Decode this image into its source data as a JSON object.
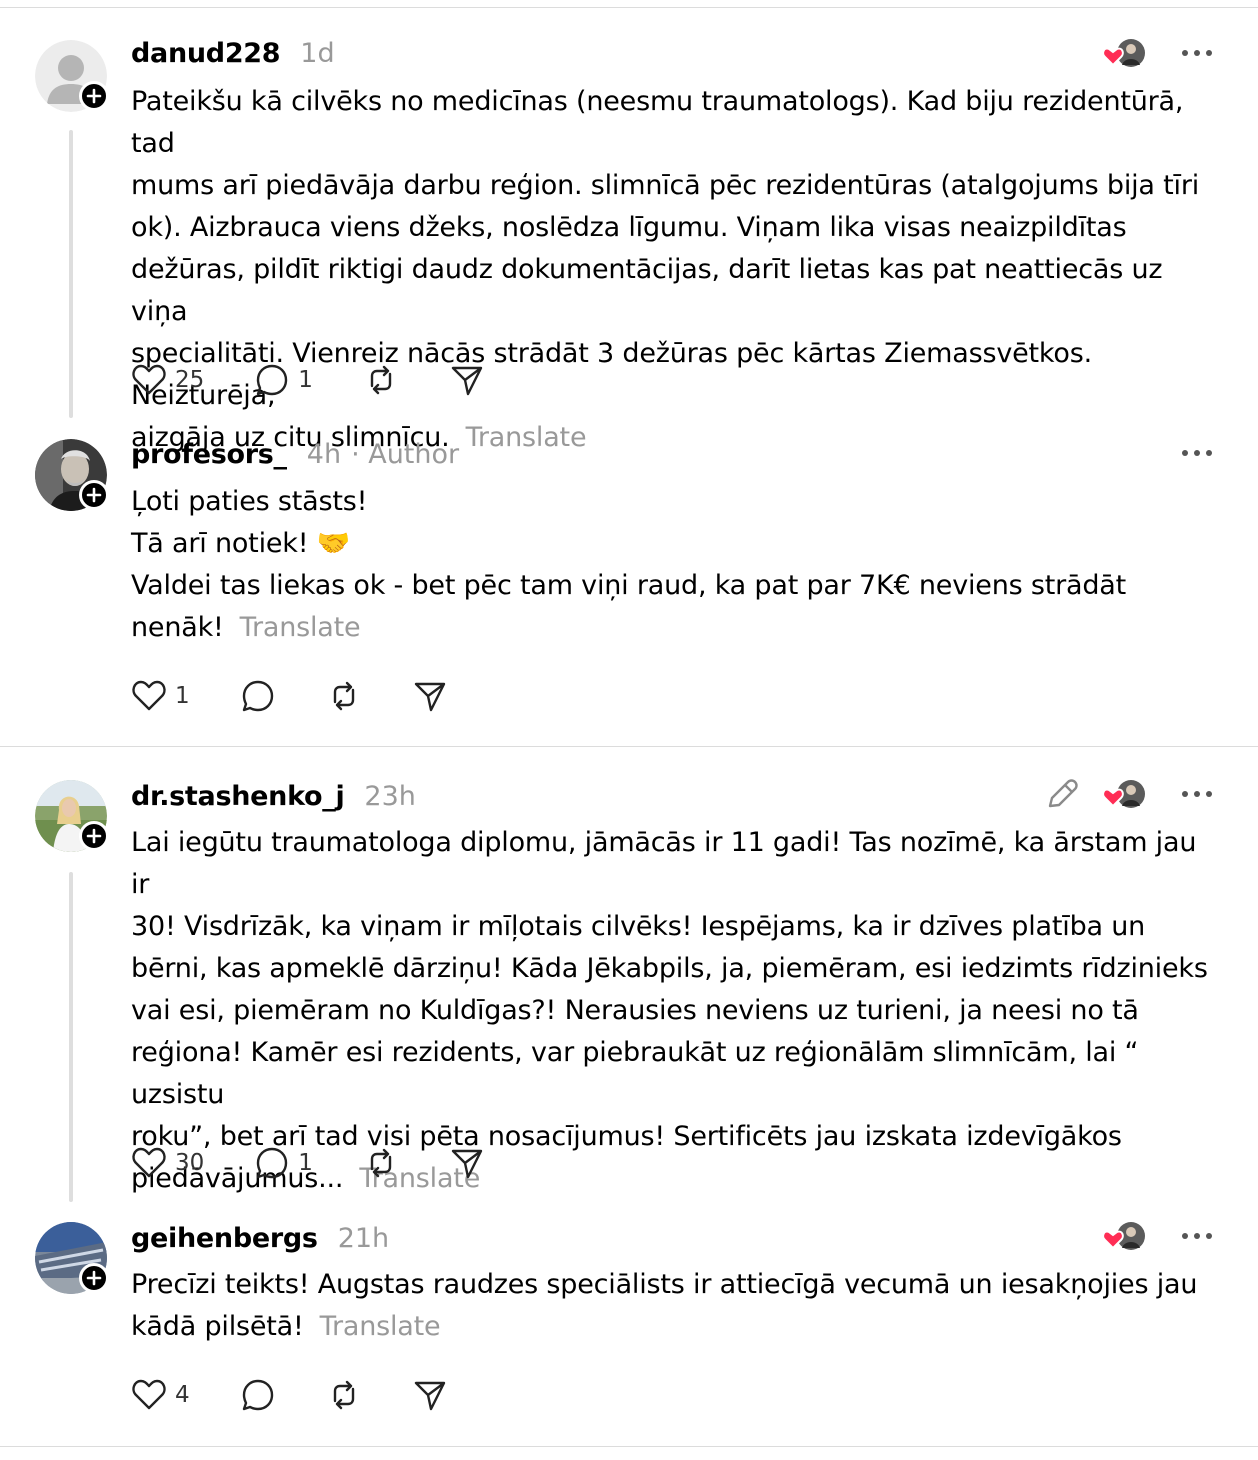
{
  "posts": [
    {
      "username": "danud228",
      "time": "1d",
      "lines": [
        "Pateikšu kā cilvēks no medicīnas (neesmu traumatologs). Kad biju rezidentūrā, tad",
        "mums arī piedāvāja darbu reģion. slimnīcā pēc rezidentūras (atalgojums bija tīri",
        "ok). Aizbrauca viens džeks, noslēdza līgumu. Viņam lika visas neaizpildītas",
        "dežūras, pildīt riktigi daudz dokumentācijas, darīt lietas kas pat neattiecās uz viņa",
        "specialitāti. Vienreiz nācās strādāt 3 dežūras pēc kārtas Ziemassvētkos. Neizturēja,",
        "aizgāja uz citu slimnīcu."
      ],
      "translate": "Translate",
      "likes": "25",
      "replies": "1"
    },
    {
      "username": "profesors_",
      "time": "4h",
      "author_badge": "· Author",
      "lines": [
        "Ļoti paties stāsts!",
        "Tā arī notiek! 🤝",
        "Valdei tas liekas ok - bet pēc tam viņi raud, ka pat par 7K€ neviens strādāt",
        "nenāk!"
      ],
      "translate": "Translate",
      "likes": "1"
    },
    {
      "username": "dr.stashenko_j",
      "time": "23h",
      "lines": [
        "Lai iegūtu traumatologa diplomu, jāmācās ir 11 gadi! Tas nozīmē, ka ārstam jau ir",
        "30! Visdrīzāk, ka viņam ir mīļotais cilvēks! Iespējams, ka ir dzīves platība un",
        "bērni, kas apmeklē dārziņu! Kāda Jēkabpils, ja, piemēram, esi iedzimts rīdzinieks",
        "vai esi, piemēram no Kuldīgas?! Nerausies neviens uz turieni, ja neesi no tā",
        "reģiona! Kamēr esi rezidents, var piebraukāt uz reģionālām slimnīcām, lai “ uzsistu",
        "roku”, bet arī tad visi pēta nosacījumus! Sertificēts jau izskata izdevīgākos",
        "piedāvājumus..."
      ],
      "translate": "Translate",
      "likes": "30",
      "replies": "1"
    },
    {
      "username": "geihenbergs",
      "time": "21h",
      "lines": [
        "Precīzi teikts! Augstas raudzes speciālists ir attiecīgā vecumā un iesakņojies jau",
        "kādā pilsētā!"
      ],
      "translate": "Translate",
      "likes": "4"
    }
  ],
  "colors": {
    "heart": "#ff2d55",
    "muted": "#999999",
    "divider": "#dcdcdc",
    "thread": "#dedede"
  }
}
